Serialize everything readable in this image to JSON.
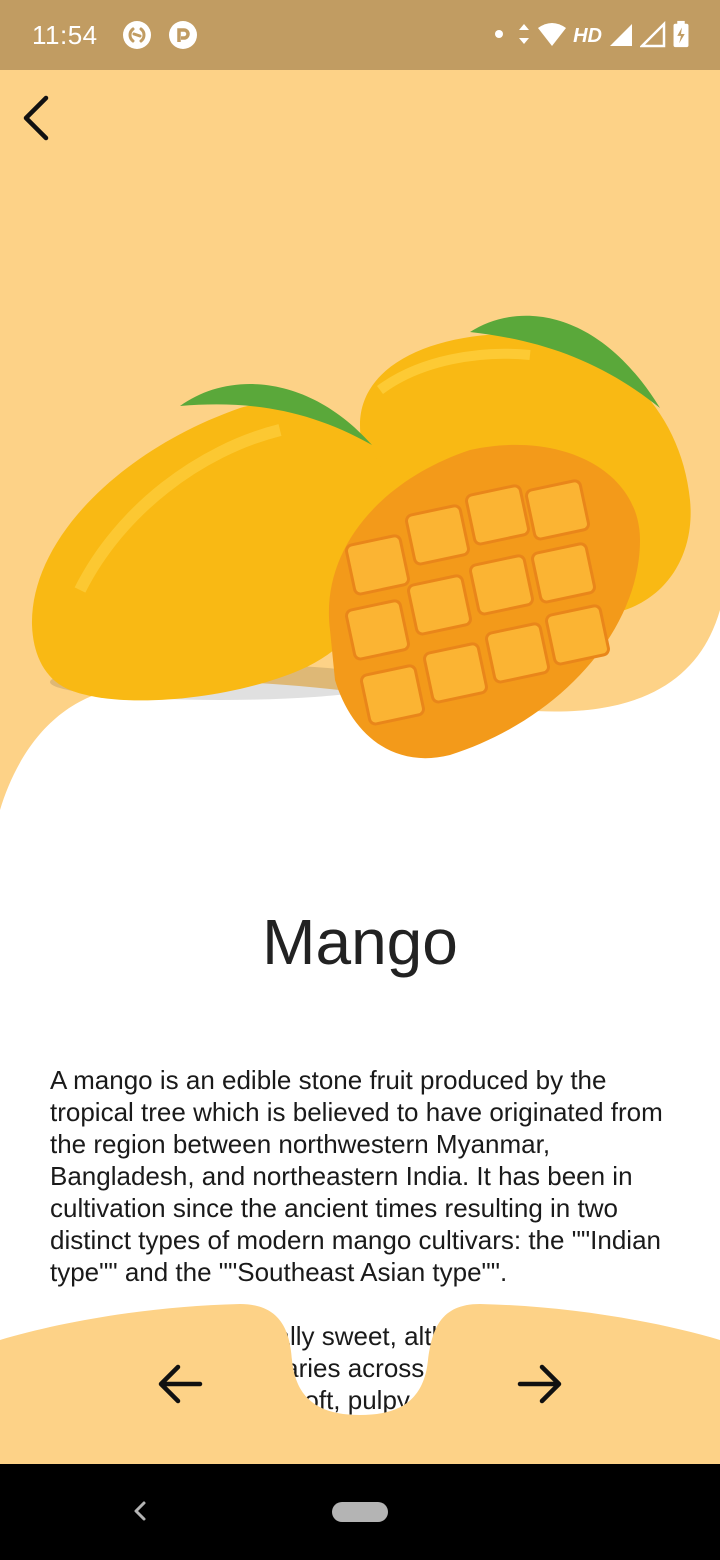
{
  "status_bar": {
    "time": "11:54",
    "network_label": "HD",
    "icons": [
      "shazam-icon",
      "pocket-casts-icon",
      "notification-dot-icon",
      "data-arrows-icon",
      "wifi-icon",
      "signal-icon",
      "signal-icon",
      "battery-charging-icon"
    ]
  },
  "detail": {
    "title": "Mango",
    "paragraphs": [
      "A mango is an edible stone fruit produced by the tropical tree which is believed to have originated from the region between northwestern Myanmar, Bangladesh, and northeastern India. It has been in cultivation since the ancient times resulting in two distinct types of modern mango cultivars: the \"\"Indian type\"\" and the \"\"Southeast Asian type\"\".",
      "Mangoes are generally sweet, although the taste and texture of the flesh varies across cultivars; some, such as Alphonso, have a soft, pulpy, juicy texture similar to an overripe plum"
    ]
  },
  "colors": {
    "status_bar": "#c19c62",
    "accent_peach": "#fdd287",
    "background": "#ffffff",
    "mango_yellow": "#f9b914",
    "mango_orange": "#f39a1a",
    "leaf_green": "#5aa83a"
  },
  "icons": {
    "back": "chevron-left-icon",
    "prev": "arrow-left-icon",
    "next": "arrow-right-icon",
    "system_back": "triangle-back-icon",
    "system_home": "home-pill-icon"
  }
}
